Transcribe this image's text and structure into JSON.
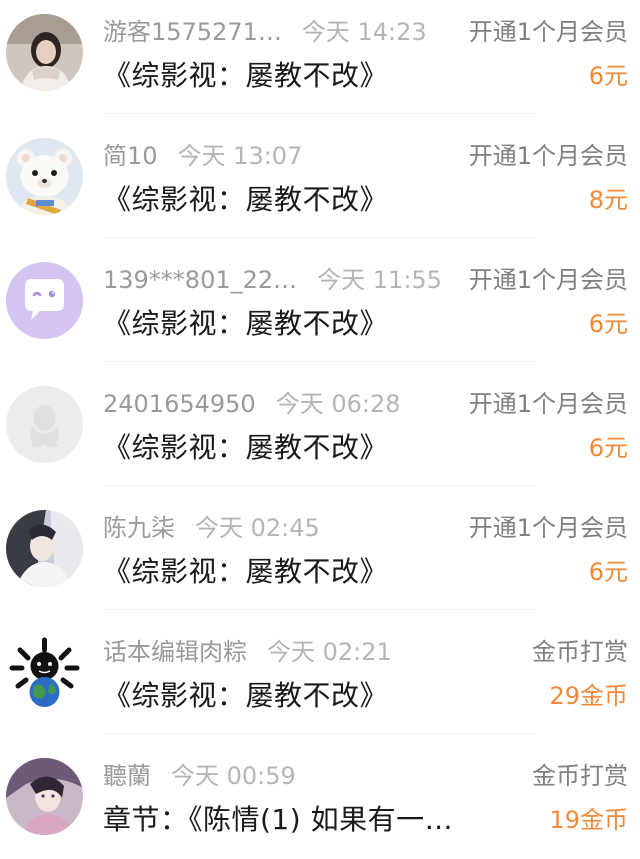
{
  "colors": {
    "accent": "#f08a3a",
    "username": "#9a9a9a",
    "time": "#b5b5b5",
    "title": "#1a1a1a",
    "type": "#808080",
    "divider": "#f0f0f0"
  },
  "records": [
    {
      "username": "游客1575271…",
      "time": "今天 14:23",
      "title": "《综影视：屡教不改》",
      "type": "开通1个月会员",
      "amount": "6元",
      "avatar_icon": "photo-avatar-girl"
    },
    {
      "username": "简10",
      "time": "今天 13:07",
      "title": "《综影视：屡教不改》",
      "type": "开通1个月会员",
      "amount": "8元",
      "avatar_icon": "teddy-bear-avatar"
    },
    {
      "username": "139***801_22…",
      "time": "今天 11:55",
      "title": "《综影视：屡教不改》",
      "type": "开通1个月会员",
      "amount": "6元",
      "avatar_icon": "chat-bubble-avatar"
    },
    {
      "username": "2401654950",
      "time": "今天 06:28",
      "title": "《综影视：屡教不改》",
      "type": "开通1个月会员",
      "amount": "6元",
      "avatar_icon": "default-penguin-avatar"
    },
    {
      "username": "陈九柒",
      "time": "今天 02:45",
      "title": "《综影视：屡教不改》",
      "type": "开通1个月会员",
      "amount": "6元",
      "avatar_icon": "anime-character-avatar"
    },
    {
      "username": "话本编辑肉粽",
      "time": "今天 02:21",
      "title": "《综影视：屡教不改》",
      "type": "金币打赏",
      "amount": "29金币",
      "avatar_icon": "globe-meme-avatar"
    },
    {
      "username": "聽蘭",
      "time": "今天 00:59",
      "title": "章节：《陈情(1) 如果有一…",
      "type": "金币打赏",
      "amount": "19金币",
      "avatar_icon": "anime-girl-avatar"
    }
  ]
}
